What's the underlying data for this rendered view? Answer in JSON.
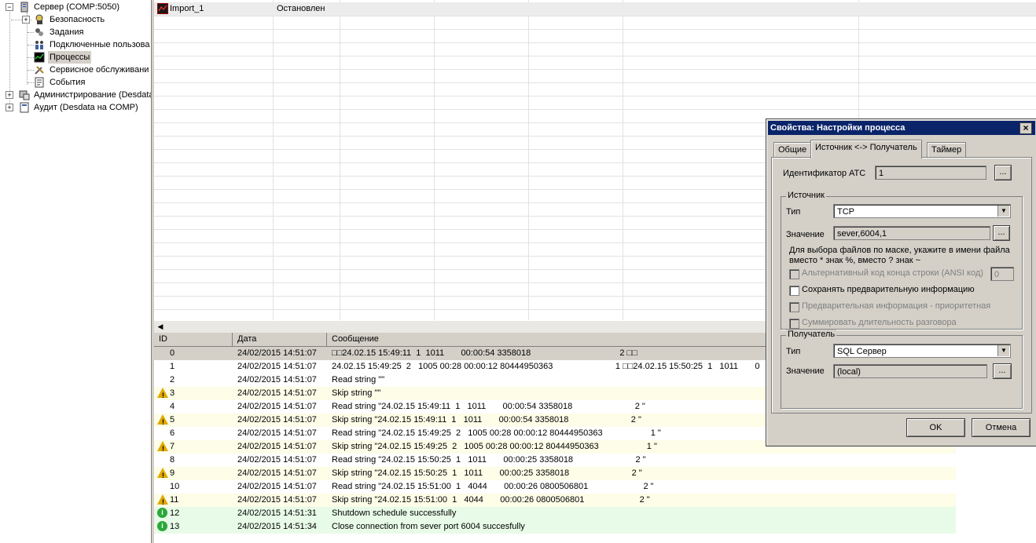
{
  "tree": {
    "server": "Сервер (COMP:5050)",
    "items": [
      {
        "label": "Безопасность"
      },
      {
        "label": "Задания"
      },
      {
        "label": "Подключенные пользова"
      },
      {
        "label": "Процессы"
      },
      {
        "label": "Сервисное обслуживани"
      },
      {
        "label": "События"
      }
    ],
    "admin": "Администрирование (Desdata",
    "audit": "Аудит (Desdata на COMP)"
  },
  "process_grid": {
    "rows": [
      {
        "name": "Import_1",
        "status": "Остановлен"
      }
    ]
  },
  "log": {
    "columns": [
      "ID",
      "Дата",
      "Сообщение"
    ],
    "rows": [
      {
        "id": "0",
        "date": "24/02/2015 14:51:07",
        "msg": "□□24.02.15 15:49:11  1  1011       00:00:54 3358018                                     2 □□",
        "icon": ""
      },
      {
        "id": "1",
        "date": "24/02/2015 14:51:07",
        "msg": "24.02.15 15:49:25  2   1005 00:28 00:00:12 80444950363                          1 □□24.02.15 15:50:25  1   1011       0",
        "icon": ""
      },
      {
        "id": "2",
        "date": "24/02/2015 14:51:07",
        "msg": "Read string \"\"",
        "icon": ""
      },
      {
        "id": "3",
        "date": "24/02/2015 14:51:07",
        "msg": "Skip string \"\"",
        "icon": "warning"
      },
      {
        "id": "4",
        "date": "24/02/2015 14:51:07",
        "msg": "Read string \"24.02.15 15:49:11  1   1011       00:00:54 3358018                          2 \"",
        "icon": ""
      },
      {
        "id": "5",
        "date": "24/02/2015 14:51:07",
        "msg": "Skip string \"24.02.15 15:49:11  1   1011       00:00:54 3358018                          2 \"",
        "icon": "warning"
      },
      {
        "id": "6",
        "date": "24/02/2015 14:51:07",
        "msg": "Read string \"24.02.15 15:49:25  2   1005 00:28 00:00:12 80444950363                    1 \"",
        "icon": ""
      },
      {
        "id": "7",
        "date": "24/02/2015 14:51:07",
        "msg": "Skip string \"24.02.15 15:49:25  2   1005 00:28 00:00:12 80444950363                    1 \"",
        "icon": "warning"
      },
      {
        "id": "8",
        "date": "24/02/2015 14:51:07",
        "msg": "Read string \"24.02.15 15:50:25  1   1011       00:00:25 3358018                          2 \"",
        "icon": ""
      },
      {
        "id": "9",
        "date": "24/02/2015 14:51:07",
        "msg": "Skip string \"24.02.15 15:50:25  1   1011       00:00:25 3358018                          2 \"",
        "icon": "warning"
      },
      {
        "id": "10",
        "date": "24/02/2015 14:51:07",
        "msg": "Read string \"24.02.15 15:51:00  1   4044       00:00:26 0800506801                       2 \"",
        "icon": ""
      },
      {
        "id": "11",
        "date": "24/02/2015 14:51:07",
        "msg": "Skip string \"24.02.15 15:51:00  1   4044       00:00:26 0800506801                       2 \"",
        "icon": "warning"
      },
      {
        "id": "12",
        "date": "24/02/2015 14:51:31",
        "msg": "Shutdown schedule successfully",
        "icon": "info"
      },
      {
        "id": "13",
        "date": "24/02/2015 14:51:34",
        "msg": "Close connection from sever port 6004 succesfully",
        "icon": "info"
      }
    ]
  },
  "dialog": {
    "title": "Свойства: Настройки процесса",
    "tabs": [
      "Общие",
      "Источник <-> Получатель",
      "Таймер"
    ],
    "atc_label": "Идентификатор АТС",
    "atc_value": "1",
    "browse": "...",
    "source": {
      "group": "Источник",
      "type_label": "Тип",
      "type_value": "TCP",
      "value_label": "Значение",
      "value_value": "sever,6004,1",
      "hint": "Для выбора файлов по маске, укажите в имени файла вместо * знак %, вместо ? знак ~",
      "alt_code_label": "Альтернативный код конца строки (ANSI код)",
      "alt_code_value": "0",
      "save_prelim": "Сохранять предварительную информацию",
      "prelim_priority": "Предварительная информация  - приоритетная",
      "sum_duration": "Суммировать длительность разговора"
    },
    "dest": {
      "group": "Получатель",
      "type_label": "Тип",
      "type_value": "SQL Сервер",
      "value_label": "Значение",
      "value_value": "(local)"
    },
    "ok": "OK",
    "cancel": "Отмена"
  },
  "colors": {
    "title_bar": "#0a246a",
    "warning_row": "#fdfde8",
    "info_row": "#e8fbe8",
    "selected_row": "#d4d0c8"
  }
}
